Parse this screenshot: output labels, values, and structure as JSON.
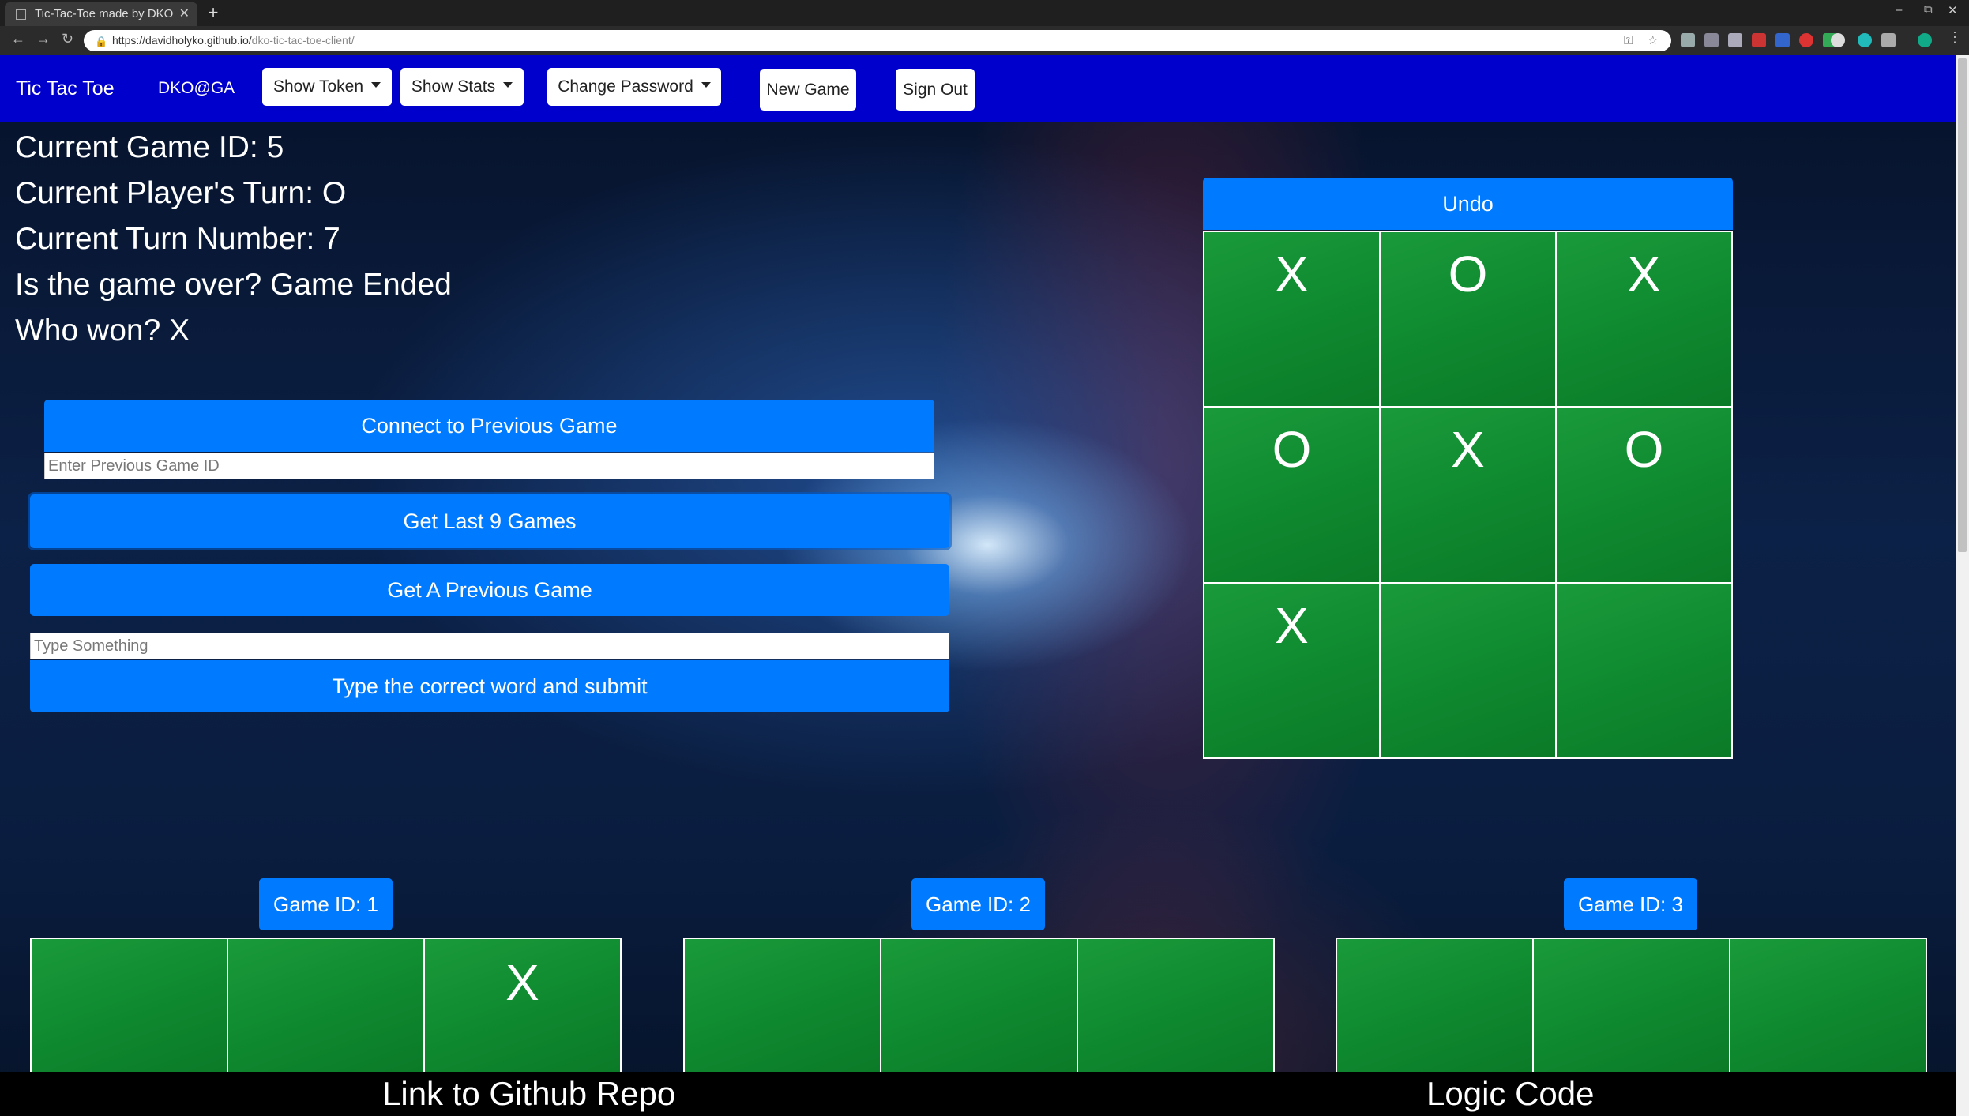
{
  "browser": {
    "tab_title": "Tic-Tac-Toe made by DKO",
    "url_host": "https://davidholyko.github.io/",
    "url_path": "dko-tic-tac-toe-client/"
  },
  "nav": {
    "brand": "Tic Tac Toe",
    "user": "DKO@GA",
    "show_token": "Show Token",
    "show_stats": "Show Stats",
    "change_password": "Change Password",
    "new_game": "New Game",
    "sign_out": "Sign Out"
  },
  "status": {
    "game_id": "Current Game ID: 5",
    "player_turn": "Current Player's Turn: O",
    "turn_number": "Current Turn Number: 7",
    "game_over": "Is the game over? Game Ended",
    "winner": "Who won? X"
  },
  "controls": {
    "connect_label": "Connect to Previous Game",
    "game_id_placeholder": "Enter Previous Game ID",
    "last9_label": "Get Last 9 Games",
    "previous_label": "Get A Previous Game",
    "word_placeholder": "Type Something",
    "submit_label": "Type the correct word and submit"
  },
  "main_board": {
    "undo_label": "Undo",
    "cells": [
      "X",
      "O",
      "X",
      "O",
      "X",
      "O",
      "X",
      "",
      ""
    ]
  },
  "previous_games": [
    {
      "label": "Game ID: 1",
      "cells": [
        "",
        "",
        "X"
      ]
    },
    {
      "label": "Game ID: 2",
      "cells": [
        "",
        "",
        ""
      ]
    },
    {
      "label": "Game ID: 3",
      "cells": [
        "",
        "",
        ""
      ]
    }
  ],
  "footer": {
    "github": "Link to Github Repo",
    "logic": "Logic Code"
  },
  "colors": {
    "navbar": "#0000cc",
    "button": "#007bff",
    "board": "#0f8a30"
  }
}
